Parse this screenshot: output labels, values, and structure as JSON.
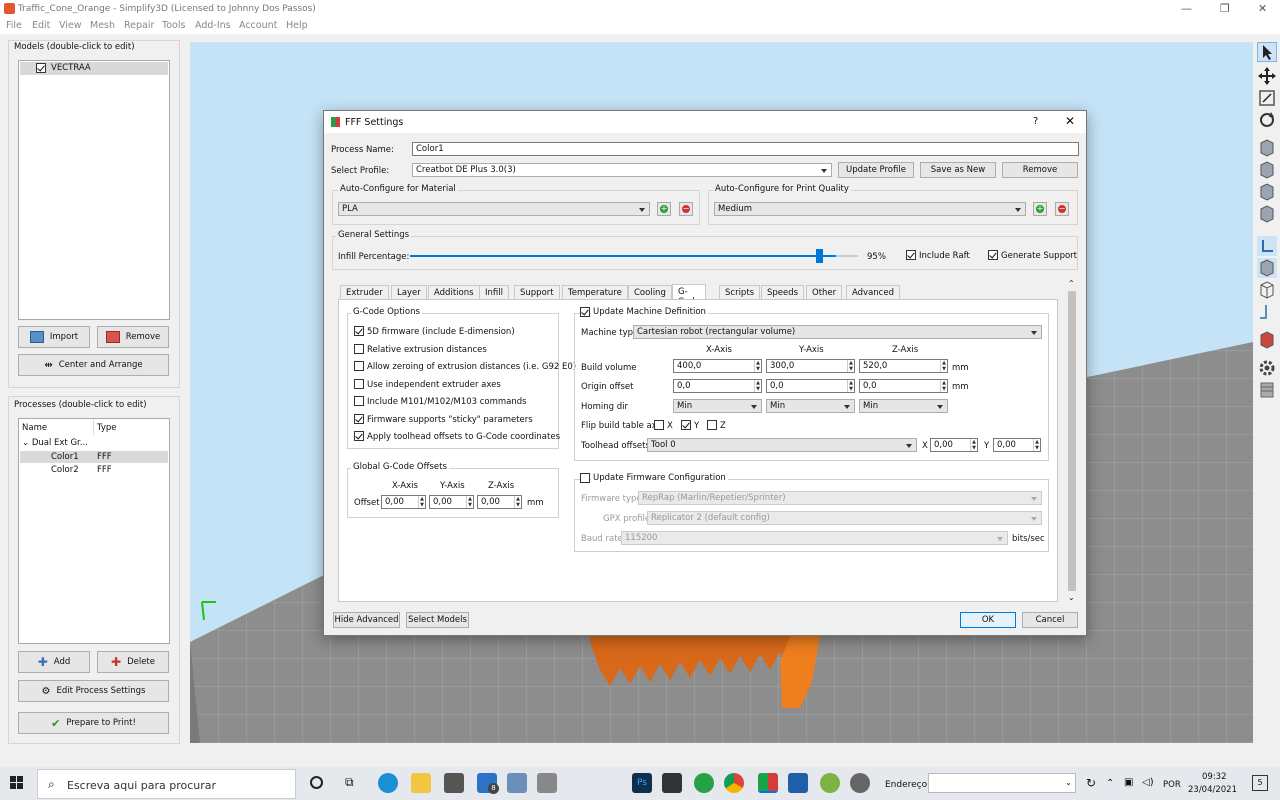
{
  "app": {
    "title": "Traffic_Cone_Orange - Simplify3D (Licensed to Johnny Dos Passos)"
  },
  "menu": [
    "File",
    "Edit",
    "View",
    "Mesh",
    "Repair",
    "Tools",
    "Add-Ins",
    "Account",
    "Help"
  ],
  "models": {
    "header": "Models (double-click to edit)",
    "items": [
      {
        "name": "VECTRAA",
        "checked": true
      }
    ],
    "import": "Import",
    "remove": "Remove",
    "center": "Center and Arrange"
  },
  "processes": {
    "header": "Processes (double-click to edit)",
    "col_name": "Name",
    "col_type": "Type",
    "group": "Dual Ext Gr...",
    "rows": [
      {
        "name": "Color1",
        "type": "FFF"
      },
      {
        "name": "Color2",
        "type": "FFF"
      }
    ],
    "add": "Add",
    "delete": "Delete",
    "edit": "Edit Process Settings",
    "prepare": "Prepare to Print!"
  },
  "dialog": {
    "title": "FFF Settings",
    "help": "?",
    "close": "✕",
    "process_name_label": "Process Name:",
    "process_name": "Color1",
    "select_profile_label": "Select Profile:",
    "profile": "Creatbot DE Plus 3.0(3)",
    "update_profile": "Update Profile",
    "save_as_new": "Save as New",
    "remove": "Remove",
    "material_header": "Auto-Configure for Material",
    "material": "PLA",
    "quality_header": "Auto-Configure for Print Quality",
    "quality": "Medium",
    "general_header": "General Settings",
    "infill_label": "Infill Percentage:",
    "infill_value": "95%",
    "infill_fraction": 0.95,
    "include_raft": "Include Raft",
    "generate_support": "Generate Support",
    "tabs": [
      "Extruder",
      "Layer",
      "Additions",
      "Infill",
      "Support",
      "Temperature",
      "Cooling",
      "G-Code",
      "Scripts",
      "Speeds",
      "Other",
      "Advanced"
    ],
    "active_tab": "G-Code",
    "gcode_options_header": "G-Code Options",
    "gcode_options": [
      {
        "label": "5D firmware (include E-dimension)",
        "checked": true
      },
      {
        "label": "Relative extrusion distances",
        "checked": false
      },
      {
        "label": "Allow zeroing of extrusion distances (i.e. G92 E0)",
        "checked": false
      },
      {
        "label": "Use independent extruder axes",
        "checked": false
      },
      {
        "label": "Include M101/M102/M103 commands",
        "checked": false
      },
      {
        "label": "Firmware supports \"sticky\" parameters",
        "checked": true
      },
      {
        "label": "Apply toolhead offsets to G-Code coordinates",
        "checked": true
      }
    ],
    "global_offsets_header": "Global G-Code Offsets",
    "x_axis": "X-Axis",
    "y_axis": "Y-Axis",
    "z_axis": "Z-Axis",
    "offset_label": "Offset",
    "offset_x": "0,00",
    "offset_y": "0,00",
    "offset_z": "0,00",
    "mm": "mm",
    "update_machine": "Update Machine Definition",
    "machine_type_label": "Machine type",
    "machine_type": "Cartesian robot (rectangular volume)",
    "build_volume_label": "Build volume",
    "build_x": "400,0",
    "build_y": "300,0",
    "build_z": "520,0",
    "origin_label": "Origin offset",
    "origin_x": "0,0",
    "origin_y": "0,0",
    "origin_z": "0,0",
    "homing_label": "Homing dir",
    "homing_x": "Min",
    "homing_y": "Min",
    "homing_z": "Min",
    "flip_label": "Flip build table axis",
    "flip_x": "X",
    "flip_y": "Y",
    "flip_z": "Z",
    "toolhead_label": "Toolhead offsets",
    "toolhead": "Tool 0",
    "th_x_label": "X",
    "th_x": "0,00",
    "th_y_label": "Y",
    "th_y": "0,00",
    "update_firmware": "Update Firmware Configuration",
    "fw_type_label": "Firmware type",
    "fw_type": "RepRap (Marlin/Repetier/Sprinter)",
    "gpx_label": "GPX profile",
    "gpx": "Replicator 2 (default config)",
    "baud_label": "Baud rate",
    "baud": "115200",
    "bits": "bits/sec",
    "hide_advanced": "Hide Advanced",
    "select_models": "Select Models",
    "ok": "OK",
    "cancel": "Cancel"
  },
  "taskbar": {
    "search": "Escreva aqui para procurar",
    "address": "Endereço",
    "lang": "POR",
    "time": "09:32",
    "date": "23/04/2021",
    "badge": "8",
    "notif": "5"
  },
  "colors": {
    "viewport_bg": "#c4e3f7",
    "floor": "#8d8d8d",
    "model": "#e2751c",
    "accent": "#0078d7"
  }
}
